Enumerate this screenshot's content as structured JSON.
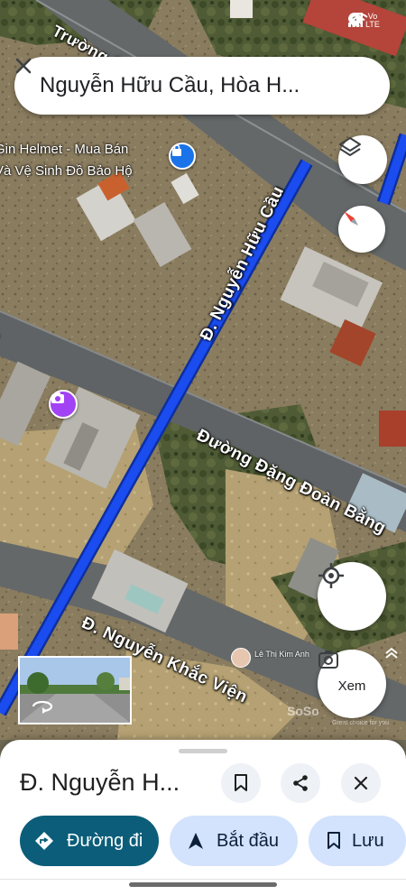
{
  "search": {
    "query": "Nguyễn Hữu Cầu, Hòa H..."
  },
  "map": {
    "road_labels": {
      "truong": "Trường C",
      "nguyen_huu_cau": "Đ. Nguyễn Hữu Cầu",
      "dang_doan_bang": "Đường Đặng Đoàn Bằng",
      "nguyen_khac_vien": "Đ. Nguyễn Khắc Viện"
    },
    "poi": {
      "line1": "Gin Helmet - Mua Bán",
      "line2": "Và Vệ Sinh Đồ Bảo Hộ"
    },
    "contributor": "Lê Thị Kim Anh",
    "watermark": "SoSo",
    "watermark_tagline": "Great choice for you",
    "lens_label": "Xem"
  },
  "status_bar": {
    "carrier": "Vo LTE"
  },
  "colors": {
    "route": "#1a4cf0",
    "accent": "#0b57d0",
    "chip_bg": "#d3e3fd",
    "primary_btn": "#0b5d79"
  },
  "sheet": {
    "title": "Đ. Nguyễn H...",
    "actions": {
      "directions": "Đường đi",
      "start": "Bắt đầu",
      "save": "Lưu"
    }
  }
}
